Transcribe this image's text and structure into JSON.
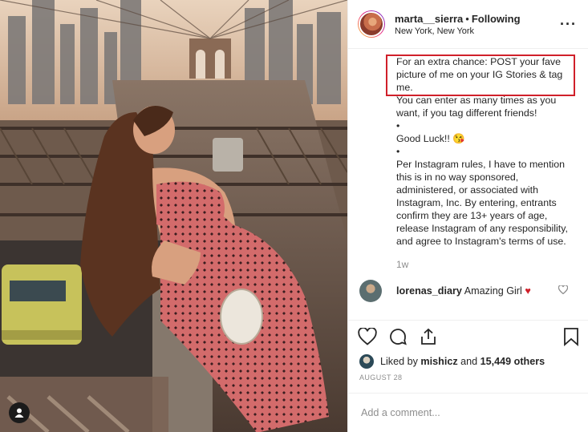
{
  "header": {
    "username": "marta__sierra",
    "separator": "•",
    "follow_status": "Following",
    "location": "New York, New York",
    "more_icon": "more-horizontal-icon"
  },
  "caption": {
    "highlighted": "For an extra chance: POST your fave picture of me on your IG Stories & tag me.",
    "lines": [
      "You can enter as many times as you want, if you tag different friends!",
      "•",
      "Good Luck!! 😘",
      "•",
      "Per Instagram rules, I have to mention this is in no way sponsored, administered, or associated with Instagram, Inc. By entering, entrants confirm they are 13+ years of age, release Instagram of any responsibility, and agree to Instagram's terms of use."
    ],
    "time": "1w"
  },
  "comments": [
    {
      "user": "lorenas_diary",
      "text": "Amazing Girl",
      "emoji": "♥"
    }
  ],
  "actions": {
    "icons": [
      "heart-icon",
      "comment-icon",
      "share-icon",
      "bookmark-icon"
    ]
  },
  "likes": {
    "prefix": "Liked by",
    "user": "mishicz",
    "connector": "and",
    "count": "15,449 others"
  },
  "date": "AUGUST 28",
  "add_comment": {
    "placeholder": "Add a comment..."
  },
  "colors": {
    "highlight_border": "#d0202a",
    "heart": "#d0202a",
    "secondary_text": "#8e8e8e"
  }
}
